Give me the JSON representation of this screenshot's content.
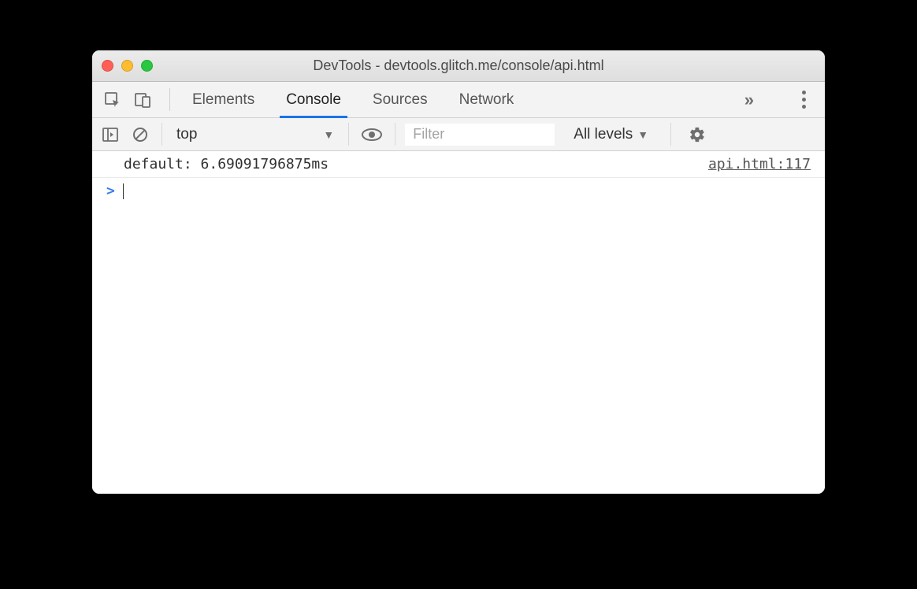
{
  "window": {
    "title": "DevTools - devtools.glitch.me/console/api.html"
  },
  "tabs": {
    "items": [
      "Elements",
      "Console",
      "Sources",
      "Network"
    ],
    "active_index": 1
  },
  "toolbar": {
    "context": "top",
    "filter_placeholder": "Filter",
    "levels_label": "All levels"
  },
  "console": {
    "rows": [
      {
        "message": "default: 6.69091796875ms",
        "source": "api.html:117"
      }
    ],
    "prompt": ">"
  }
}
